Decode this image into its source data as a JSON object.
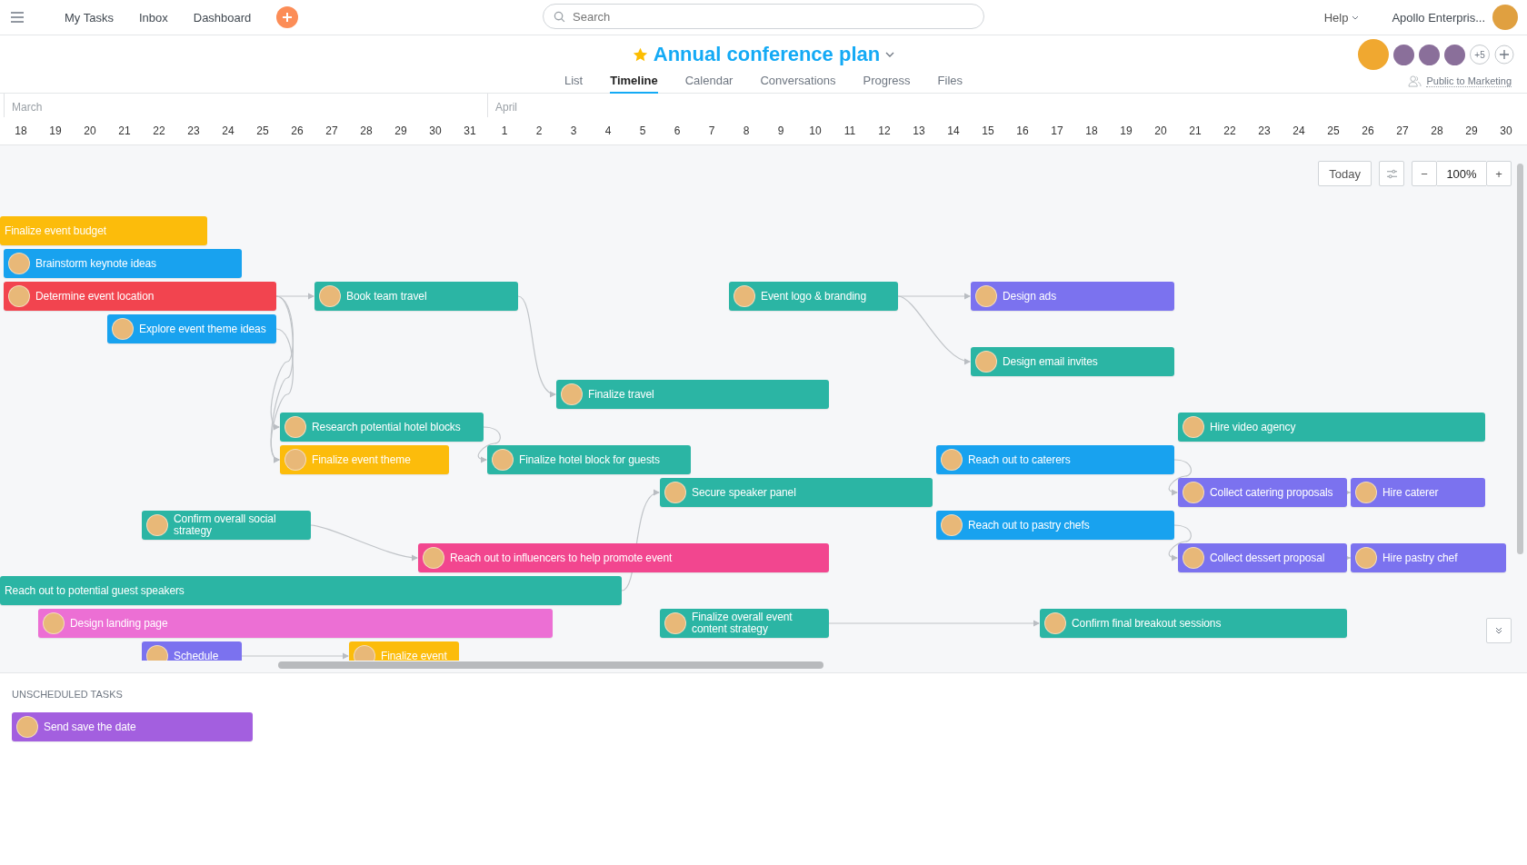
{
  "topbar": {
    "nav": [
      "My Tasks",
      "Inbox",
      "Dashboard"
    ],
    "search": {
      "placeholder": "Search"
    },
    "help": "Help",
    "workspace": "Apollo Enterpris..."
  },
  "project": {
    "title": "Annual conference plan",
    "starred": true,
    "members_more": "+5",
    "privacy": "Public to Marketing"
  },
  "tabs": [
    {
      "label": "List",
      "selected": false
    },
    {
      "label": "Timeline",
      "selected": true
    },
    {
      "label": "Calendar",
      "selected": false
    },
    {
      "label": "Conversations",
      "selected": false
    },
    {
      "label": "Progress",
      "selected": false
    },
    {
      "label": "Files",
      "selected": false
    }
  ],
  "months": [
    {
      "name": "March",
      "days": [
        "18",
        "19",
        "20",
        "21",
        "22",
        "23",
        "24",
        "25",
        "26",
        "27",
        "28",
        "29",
        "30",
        "31"
      ]
    },
    {
      "name": "April",
      "days": [
        "1",
        "2",
        "3",
        "4",
        "5",
        "6",
        "7",
        "8",
        "9",
        "10",
        "11",
        "12",
        "13",
        "14",
        "15",
        "16",
        "17",
        "18",
        "19",
        "20",
        "21",
        "22",
        "23",
        "24",
        "25",
        "26",
        "27",
        "28",
        "29",
        "30"
      ]
    }
  ],
  "controls": {
    "today": "Today",
    "zoom_out": "−",
    "zoom": "100%",
    "zoom_in": "+"
  },
  "tasks": [
    {
      "name": "Finalize event budget",
      "color": "#fcbc0b",
      "avatar": false
    },
    {
      "name": "Brainstorm keynote ideas",
      "color": "#18a2ef",
      "avatar": true
    },
    {
      "name": "Determine event location",
      "color": "#f2444f",
      "avatar": true
    },
    {
      "name": "Book team travel",
      "color": "#2bb5a4",
      "avatar": true
    },
    {
      "name": "Event logo & branding",
      "color": "#2bb5a4",
      "avatar": true
    },
    {
      "name": "Design ads",
      "color": "#7b72ef",
      "avatar": true
    },
    {
      "name": "Explore event theme ideas",
      "color": "#18a2ef",
      "avatar": true
    },
    {
      "name": "Design email invites",
      "color": "#2bb5a4",
      "avatar": true
    },
    {
      "name": "Finalize travel",
      "color": "#2bb5a4",
      "avatar": true
    },
    {
      "name": "Research potential hotel blocks",
      "color": "#2bb5a4",
      "avatar": true
    },
    {
      "name": "Hire video agency",
      "color": "#2bb5a4",
      "avatar": true
    },
    {
      "name": "Finalize event theme",
      "color": "#fcbc0b",
      "avatar": true
    },
    {
      "name": "Finalize hotel block for guests",
      "color": "#2bb5a4",
      "avatar": true
    },
    {
      "name": "Reach out to caterers",
      "color": "#18a2ef",
      "avatar": true
    },
    {
      "name": "Secure speaker panel",
      "color": "#2bb5a4",
      "avatar": true
    },
    {
      "name": "Collect catering proposals",
      "color": "#7b72ef",
      "avatar": true
    },
    {
      "name": "Hire caterer",
      "color": "#7b72ef",
      "avatar": true
    },
    {
      "name": "Confirm overall social strategy",
      "color": "#2bb5a4",
      "avatar": true
    },
    {
      "name": "Reach out to pastry chefs",
      "color": "#18a2ef",
      "avatar": true
    },
    {
      "name": "Reach out to influencers to help promote event",
      "color": "#f2468f",
      "avatar": true
    },
    {
      "name": "Collect dessert proposal",
      "color": "#7b72ef",
      "avatar": true
    },
    {
      "name": "Hire pastry chef",
      "color": "#7b72ef",
      "avatar": true
    },
    {
      "name": "Reach out to potential guest speakers",
      "color": "#2bb5a4",
      "avatar": false
    },
    {
      "name": "Design landing page",
      "color": "#ec6fd4",
      "avatar": true
    },
    {
      "name": "Finalize overall event content strategy",
      "color": "#2bb5a4",
      "avatar": true
    },
    {
      "name": "Confirm final breakout sessions",
      "color": "#2bb5a4",
      "avatar": true
    },
    {
      "name": "Schedule",
      "color": "#7b72ef",
      "avatar": true
    },
    {
      "name": "Finalize event",
      "color": "#fcbc0b",
      "avatar": true
    }
  ],
  "unscheduled": {
    "heading": "UNSCHEDULED TASKS",
    "tasks": [
      {
        "name": "Send save the date",
        "color": "#a35fdf",
        "avatar": true
      }
    ]
  }
}
